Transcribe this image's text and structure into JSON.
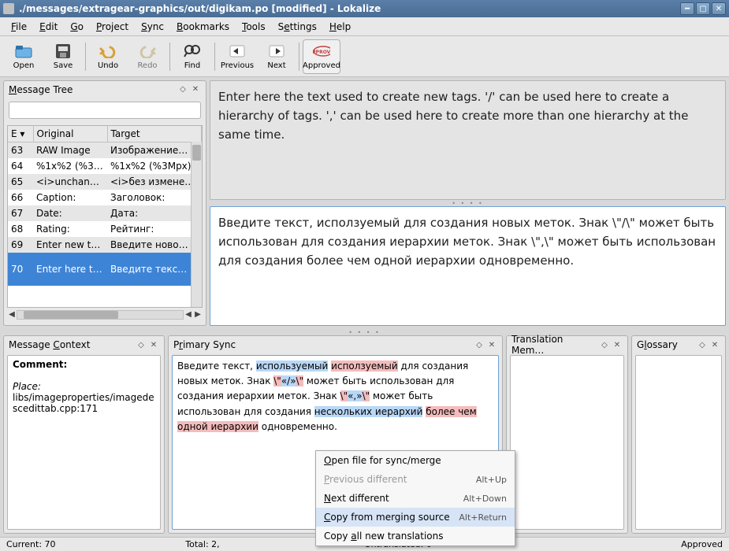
{
  "window": {
    "title": "./messages/extragear-graphics/out/digikam.po [modified] - Lokalize"
  },
  "menubar": [
    {
      "label": "File",
      "accel": "F"
    },
    {
      "label": "Edit",
      "accel": "E"
    },
    {
      "label": "Go",
      "accel": "G"
    },
    {
      "label": "Project",
      "accel": "P"
    },
    {
      "label": "Sync",
      "accel": "S"
    },
    {
      "label": "Bookmarks",
      "accel": "B"
    },
    {
      "label": "Tools",
      "accel": "T"
    },
    {
      "label": "Settings",
      "accel": "S"
    },
    {
      "label": "Help",
      "accel": "H"
    }
  ],
  "toolbar": {
    "open": "Open",
    "save": "Save",
    "undo": "Undo",
    "redo": "Redo",
    "find": "Find",
    "previous": "Previous",
    "next": "Next",
    "approved": "Approved"
  },
  "panels": {
    "message_tree": "Message Tree",
    "message_context": "Message Context",
    "primary_sync": "Primary Sync",
    "translation_memory": "Translation Mem…",
    "glossary": "Glossary"
  },
  "tableHeaders": {
    "entry": "E",
    "original": "Original",
    "target": "Target"
  },
  "rows": [
    {
      "n": "63",
      "orig": "RAW Image",
      "tgt": "Изображение…"
    },
    {
      "n": "64",
      "orig": "%1x%2 (%3Mpx)",
      "tgt": "%1x%2 (%3Mpx)"
    },
    {
      "n": "65",
      "orig": "<i>unchanged…",
      "tgt": "<i>без измене…"
    },
    {
      "n": "66",
      "orig": "Caption:",
      "tgt": "Заголовок:"
    },
    {
      "n": "67",
      "orig": "Date:",
      "tgt": "Дата:"
    },
    {
      "n": "68",
      "orig": "Rating:",
      "tgt": "Рейтинг:"
    },
    {
      "n": "69",
      "orig": "Enter new tag …",
      "tgt": "Введите ново…"
    },
    {
      "n": "70",
      "orig": "Enter here the …",
      "tgt": "Введите текс…"
    }
  ],
  "sourceText": "Enter here the text used to create new tags. '/' can be used here to create a hierarchy of tags. ',' can be used here to create more than one hierarchy at the same time.",
  "targetText": "Введите текст, исползуемый для создания новых меток. Знак \\\"/\\\" может быть использован для создания иерархии меток. Знак \\\",\\\" может быть использован для создания более чем одной иерархии одновременно.",
  "context": {
    "comment_label": "Comment:",
    "place_label": "Place:",
    "place_value": "libs/imageproperties/imagedescedittab.cpp:171"
  },
  "primarySync": {
    "p1": "Введите текст, ",
    "old1": "используемый",
    "sp1": " ",
    "new1": "исползуемый",
    "p2": " для создания новых меток. Знак ",
    "new2": "\\\"",
    "old2": "«/»",
    "new3": "\\\"",
    "p3": " может быть использован для создания иерархии меток. Знак ",
    "new4": "\\\"",
    "old3": "«,»",
    "new5": "\\\"",
    "p4": " может быть использован для создания ",
    "old4": "нескольких иерархий",
    "sp2": " ",
    "new6": "более чем одной иерархии",
    "p5": " одновременно."
  },
  "ctxmenu": {
    "open": "Open file for sync/merge",
    "prev": "Previous different",
    "prev_sc": "Alt+Up",
    "next": "Next different",
    "next_sc": "Alt+Down",
    "copy": "Copy from merging source",
    "copy_sc": "Alt+Return",
    "copyall": "Copy all new translations"
  },
  "status": {
    "current": "Current: 70",
    "total": "Total: 2,",
    "untranslated": "Untranslated: 0",
    "approved": "Approved"
  }
}
